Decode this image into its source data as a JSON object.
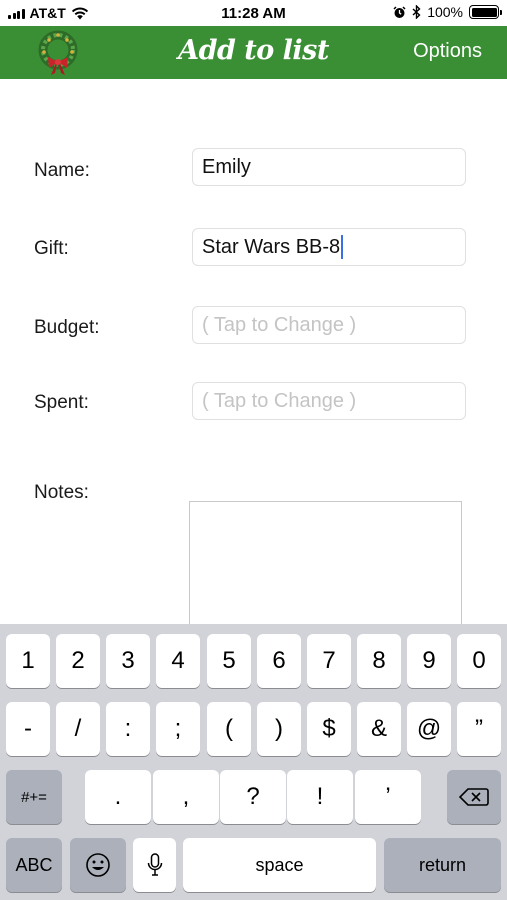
{
  "status_bar": {
    "carrier": "AT&T",
    "time": "11:28 AM",
    "battery_percent": "100%",
    "battery_level": 1.0,
    "icons": [
      "signal-icon",
      "wifi-icon",
      "alarm-icon",
      "bluetooth-icon",
      "battery-icon"
    ]
  },
  "nav": {
    "title": "Add to list",
    "options_label": "Options",
    "logo": "wreath-icon",
    "color": "#3a8f34"
  },
  "form": {
    "name_label": "Name:",
    "name_value": "Emily",
    "gift_label": "Gift:",
    "gift_value": "Star Wars BB-8",
    "budget_label": "Budget:",
    "budget_placeholder": "( Tap to Change )",
    "spent_label": "Spent:",
    "spent_placeholder": "( Tap to Change )",
    "notes_label": "Notes:",
    "notes_value": ""
  },
  "keyboard": {
    "row1": [
      "1",
      "2",
      "3",
      "4",
      "5",
      "6",
      "7",
      "8",
      "9",
      "0"
    ],
    "row2": [
      "-",
      "/",
      ":",
      ";",
      "(",
      ")",
      "$",
      "&",
      "@",
      "”"
    ],
    "symbols_key": "#+=",
    "row3": [
      ".",
      ",",
      "?",
      "!",
      "’"
    ],
    "delete_icon": "backspace-icon",
    "abc_key": "ABC",
    "emoji_icon": "emoji-icon",
    "mic_icon": "microphone-icon",
    "space_key": "space",
    "return_key": "return"
  }
}
